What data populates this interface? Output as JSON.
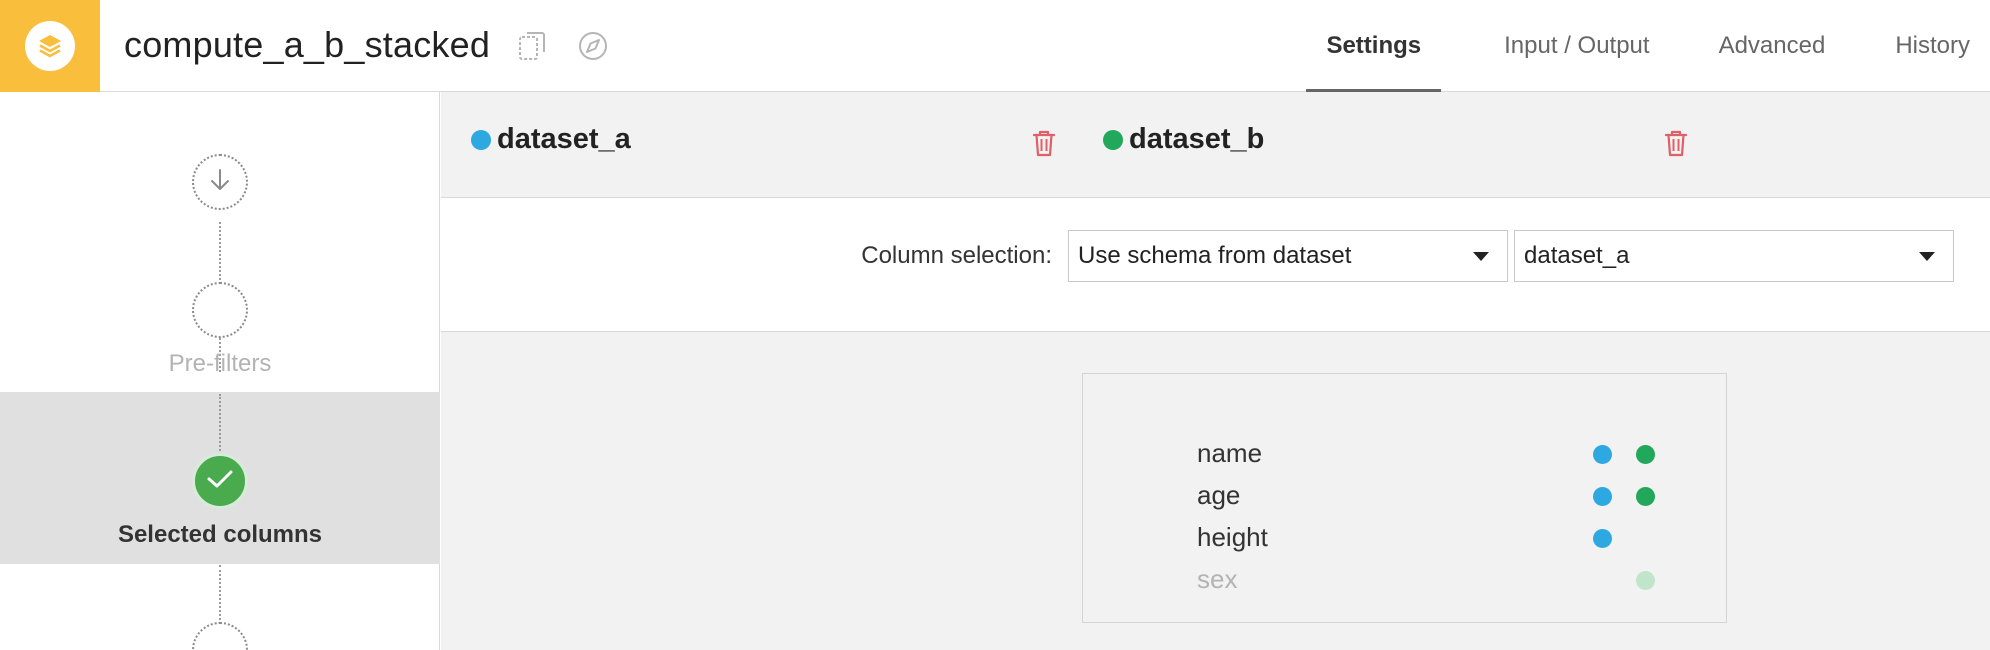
{
  "header": {
    "title": "compute_a_b_stacked",
    "brand_color": "#f9be3c",
    "icons": [
      "stack-icon",
      "copy-icon",
      "compass-icon"
    ],
    "tabs": [
      {
        "label": "Settings",
        "active": true
      },
      {
        "label": "Input / Output",
        "active": false
      },
      {
        "label": "Advanced",
        "active": false
      },
      {
        "label": "History",
        "active": false
      }
    ]
  },
  "sidebar": {
    "steps": [
      {
        "label": "",
        "icon": "arrow-down-icon",
        "state": "default"
      },
      {
        "label": "Pre-filters",
        "state": "inactive"
      },
      {
        "label": "Selected columns",
        "state": "selected"
      },
      {
        "label": "",
        "state": "default"
      }
    ]
  },
  "main": {
    "datasets": [
      {
        "name": "dataset_a",
        "color": "#2da8e0"
      },
      {
        "name": "dataset_b",
        "color": "#22a85a"
      }
    ],
    "column_selection": {
      "label": "Column selection:",
      "mode_value": "Use schema from dataset",
      "dataset_value": "dataset_a"
    },
    "columns": [
      {
        "name": "name",
        "in_a": true,
        "in_b": true,
        "muted": false
      },
      {
        "name": "age",
        "in_a": true,
        "in_b": true,
        "muted": false
      },
      {
        "name": "height",
        "in_a": true,
        "in_b": false,
        "muted": false
      },
      {
        "name": "sex",
        "in_a": false,
        "in_b": true,
        "muted": true
      }
    ]
  }
}
